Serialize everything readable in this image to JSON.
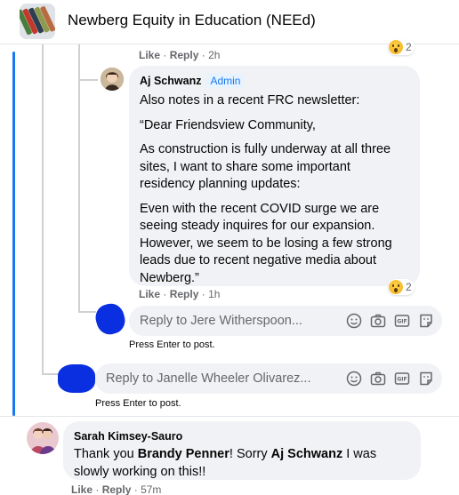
{
  "group": {
    "title": "Newberg Equity in Education (NEEd)"
  },
  "top_meta": {
    "like": "Like",
    "sep": "·",
    "reply": "Reply",
    "time": "2h",
    "reaction_count": "2"
  },
  "comment1": {
    "author": "Aj Schwanz",
    "badge": "Admin",
    "paragraphs": [
      "Also notes in a recent FRC newsletter:",
      "“Dear Friendsview Community,",
      "As construction is fully underway at all three sites, I want to share some important residency planning updates:",
      "Even with the recent COVID surge we are seeing steady inquires for our expansion. However, we seem to be losing a few strong leads due to recent negative media about Newberg.”"
    ],
    "like": "Like",
    "reply": "Reply",
    "time": "1h",
    "reaction_count": "2",
    "reaction_icon": "wow-emoji-icon"
  },
  "reply_box1": {
    "placeholder": "Reply to Jere Witherspoon...",
    "hint": "Press Enter to post."
  },
  "reply_box2": {
    "placeholder": "Reply to Janelle Wheeler Olivarez...",
    "hint": "Press Enter to post."
  },
  "comment2": {
    "author": "Sarah Kimsey-Sauro",
    "text_before": "Thank you ",
    "mention1": "Brandy Penner",
    "text_middle": "! Sorry ",
    "mention2": "Aj Schwanz",
    "text_after": " I was slowly working on this!!",
    "like": "Like",
    "reply": "Reply",
    "time": "57m"
  },
  "toolbar_icons": [
    "emoji-icon",
    "camera-icon",
    "gif-icon",
    "sticker-icon"
  ],
  "colors": {
    "link_blue": "#1877f2",
    "bubble_bg": "#f0f2f5",
    "meta_gray": "#65676b",
    "redaction_blue": "#0a2fe0"
  }
}
